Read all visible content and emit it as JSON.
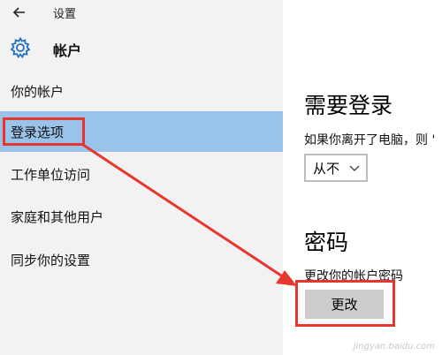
{
  "window": {
    "title": "设置",
    "back_icon": "arrow-left-icon"
  },
  "header": {
    "title": "帐户",
    "icon": "gear-icon",
    "icon_color": "#1e6fc7"
  },
  "sidebar": {
    "selected_color": "#99c3e8",
    "items": [
      {
        "label": "你的帐户"
      },
      {
        "label": "登录选项",
        "selected": true
      },
      {
        "label": "工作单位访问"
      },
      {
        "label": "家庭和其他用户"
      },
      {
        "label": "同步你的设置"
      }
    ]
  },
  "main": {
    "require_signin": {
      "title": "需要登录",
      "description": "如果你离开了电脑，则 '",
      "dropdown_value": "从不"
    },
    "password": {
      "title": "密码",
      "description": "更改你的帐户密码",
      "button_label": "更改"
    }
  },
  "annotation": {
    "color": "#e8362f"
  }
}
